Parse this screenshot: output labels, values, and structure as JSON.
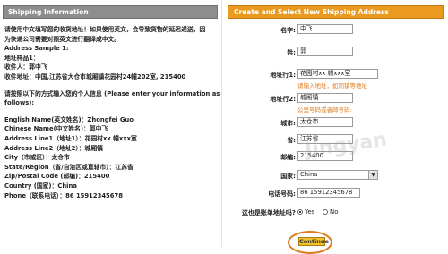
{
  "left": {
    "title": "Shipping Information",
    "lines": [
      "请使用中文填写您的收货地址！如果使用英文，会导致货物的延迟递送，因",
      "为快递公司需要对照英文进行翻译成中文。",
      "Address Sample 1:",
      "地址样品1：",
      "收件人：郭中飞",
      "收件地址：中国,江苏省大仓市城厢镇花园村24幢202室, 215400",
      "",
      "请按照以下的方式输入您的个人信息 (Please enter your information as",
      "follows):",
      "",
      "English Name(英文姓名)：Zhongfei Guo",
      "Chinese Name(中文姓名)：郭中飞",
      "Address Line1（地址1）：花园村xx 幢xxx室",
      "Address Line2（地址2）：城厢镇",
      "City（市或区）：太仓市",
      "State/Region（省/自治区或直辖市）：江苏省",
      "Zip/Postal Code (邮编)：215400",
      "Country (国家)：China",
      "Phone（联系电话）：86 15912345678"
    ]
  },
  "right": {
    "title": "Create and Select New Shipping Address",
    "first_name": {
      "label": "名字:",
      "value": "中飞"
    },
    "last_name": {
      "label": "姓:",
      "value": "郭"
    },
    "address1": {
      "label": "地址行1:",
      "value": "花园村xx 幢xxx室",
      "hint": "请输入地址，如同镇等地址"
    },
    "address2": {
      "label": "地址行2:",
      "value": "城厢镇",
      "hint": "公里号码或者邮号码:"
    },
    "city": {
      "label": "城市:",
      "value": "太仓市"
    },
    "province": {
      "label": "省:",
      "value": "江苏省"
    },
    "zip": {
      "label": "邮编:",
      "value": "215400"
    },
    "country": {
      "label": "国家:",
      "value": "China"
    },
    "phone": {
      "label": "电话号码:",
      "value": "86 15912345678"
    },
    "default_question": "这也是账单地址吗?",
    "yes_label": "Yes",
    "no_label": "No",
    "continue_label": "Continue"
  },
  "watermark": "Jingyan"
}
